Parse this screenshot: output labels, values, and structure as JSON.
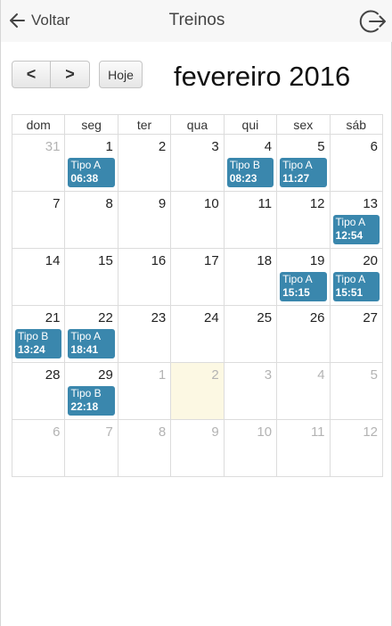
{
  "nav": {
    "back_label": "Voltar",
    "title": "Treinos"
  },
  "toolbar": {
    "prev_label": "<",
    "next_label": ">",
    "today_label": "Hoje",
    "month_title": "fevereiro 2016"
  },
  "calendar": {
    "weekdays": [
      "dom",
      "seg",
      "ter",
      "qua",
      "qui",
      "sex",
      "sáb"
    ],
    "weeks": [
      [
        {
          "day": "31",
          "other": true
        },
        {
          "day": "1",
          "event": {
            "type": "Tipo A",
            "time": "06:38"
          }
        },
        {
          "day": "2"
        },
        {
          "day": "3"
        },
        {
          "day": "4",
          "event": {
            "type": "Tipo B",
            "time": "08:23"
          }
        },
        {
          "day": "5",
          "event": {
            "type": "Tipo A",
            "time": "11:27"
          }
        },
        {
          "day": "6"
        }
      ],
      [
        {
          "day": "7"
        },
        {
          "day": "8"
        },
        {
          "day": "9"
        },
        {
          "day": "10"
        },
        {
          "day": "11"
        },
        {
          "day": "12"
        },
        {
          "day": "13",
          "event": {
            "type": "Tipo A",
            "time": "12:54"
          }
        }
      ],
      [
        {
          "day": "14"
        },
        {
          "day": "15"
        },
        {
          "day": "16"
        },
        {
          "day": "17"
        },
        {
          "day": "18"
        },
        {
          "day": "19",
          "event": {
            "type": "Tipo A",
            "time": "15:15"
          }
        },
        {
          "day": "20",
          "event": {
            "type": "Tipo A",
            "time": "15:51"
          }
        }
      ],
      [
        {
          "day": "21",
          "event": {
            "type": "Tipo B",
            "time": "13:24"
          }
        },
        {
          "day": "22",
          "event": {
            "type": "Tipo A",
            "time": "18:41"
          }
        },
        {
          "day": "23"
        },
        {
          "day": "24"
        },
        {
          "day": "25"
        },
        {
          "day": "26"
        },
        {
          "day": "27"
        }
      ],
      [
        {
          "day": "28"
        },
        {
          "day": "29",
          "event": {
            "type": "Tipo B",
            "time": "22:18"
          }
        },
        {
          "day": "1",
          "other": true
        },
        {
          "day": "2",
          "other": true,
          "today": true
        },
        {
          "day": "3",
          "other": true
        },
        {
          "day": "4",
          "other": true
        },
        {
          "day": "5",
          "other": true
        }
      ],
      [
        {
          "day": "6",
          "other": true
        },
        {
          "day": "7",
          "other": true
        },
        {
          "day": "8",
          "other": true
        },
        {
          "day": "9",
          "other": true
        },
        {
          "day": "10",
          "other": true
        },
        {
          "day": "11",
          "other": true
        },
        {
          "day": "12",
          "other": true
        }
      ]
    ]
  },
  "colors": {
    "event_bg": "#3a87ad",
    "today_bg": "#fcf8e3",
    "navbar_bg": "#f7f7f7"
  },
  "icons": {
    "back": "arrow-left-icon",
    "logout": "logout-icon"
  }
}
